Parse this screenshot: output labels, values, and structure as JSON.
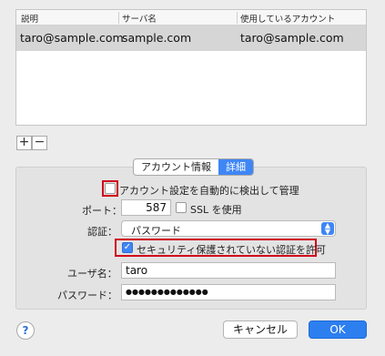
{
  "table": {
    "headers": [
      "説明",
      "サーバ名",
      "使用しているアカウント"
    ],
    "rows": [
      {
        "description": "taro@sample.com",
        "server": "sample.com",
        "account": "taro@sample.com"
      }
    ]
  },
  "list_buttons": {
    "add": "+",
    "remove": "−"
  },
  "tabs": [
    {
      "label": "アカウント情報",
      "active": false
    },
    {
      "label": "詳細",
      "active": true
    }
  ],
  "settings": {
    "auto_detect_label": "アカウント設定を自動的に検出して管理",
    "auto_detect_checked": false,
    "port_label": "ポート：",
    "port_value": "587",
    "ssl_label": "SSL を使用",
    "ssl_checked": false,
    "auth_label": "認証：",
    "auth_value": "パスワード",
    "insecure_auth_label": "セキュリティ保護されていない認証を許可",
    "insecure_auth_checked": true,
    "username_label": "ユーザ名：",
    "username_value": "taro",
    "password_label": "パスワード：",
    "password_value": "●●●●●●●●●●●●●"
  },
  "footer": {
    "help": "?",
    "cancel": "キャンセル",
    "ok": "OK"
  },
  "colors": {
    "accent": "#3f86f5",
    "highlight_box": "#d0021b",
    "selected_row": "#d6d6d6"
  }
}
